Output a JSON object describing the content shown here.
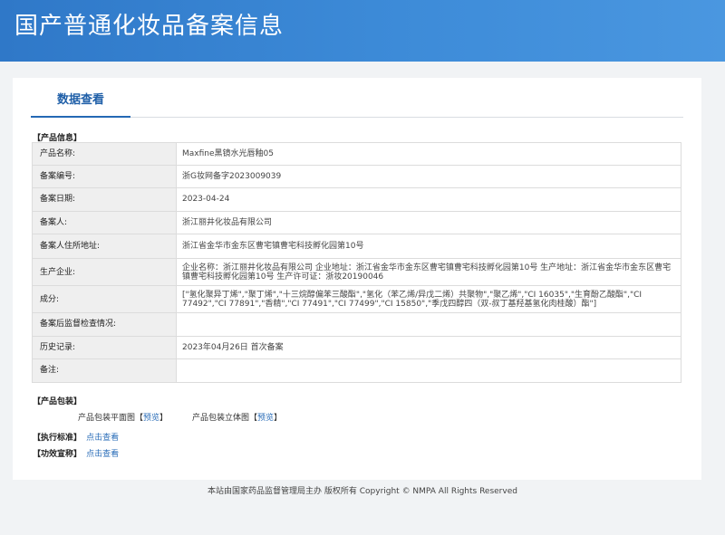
{
  "header": {
    "title": "国产普通化妆品备案信息"
  },
  "tabs": [
    {
      "label": "数据查看"
    }
  ],
  "sections": {
    "product_info": "【产品信息】",
    "packaging": "【产品包装】",
    "standard": "【执行标准】",
    "efficacy": "【功效宣称】"
  },
  "rows": [
    {
      "label": "产品名称:",
      "value": "Maxfine黑镜水光唇釉05"
    },
    {
      "label": "备案编号:",
      "value": "浙G妆网备字2023009039"
    },
    {
      "label": "备案日期:",
      "value": "2023-04-24"
    },
    {
      "label": "备案人:",
      "value": "浙江丽井化妆品有限公司"
    },
    {
      "label": "备案人住所地址:",
      "value": "浙江省金华市金东区曹宅镇曹宅科技孵化园第10号"
    },
    {
      "label": "生产企业:",
      "value": "企业名称：浙江丽井化妆品有限公司 企业地址：浙江省金华市金东区曹宅镇曹宅科技孵化园第10号 生产地址：浙江省金华市金东区曹宅镇曹宅科技孵化园第10号 生产许可证：浙妆20190046"
    },
    {
      "label": "成分:",
      "value": "[\"氢化聚异丁烯\",\"聚丁烯\",\"十三烷醇偏苯三酸酯\",\"氢化（苯乙烯/异戊二烯）共聚物\",\"聚乙烯\",\"CI 16035\",\"生育酚乙酸酯\",\"CI 77492\",\"CI 77891\",\"香精\",\"CI 77491\",\"CI 77499\",\"CI 15850\",\"季戊四醇四（双-叔丁基羟基氢化肉桂酸）酯\"]"
    },
    {
      "label": "备案后监督检查情况:",
      "value": ""
    },
    {
      "label": "历史记录:",
      "value": "2023年04月26日 首次备案"
    },
    {
      "label": "备注:",
      "value": ""
    }
  ],
  "packaging": {
    "flat_label": "产品包装平面图",
    "stereo_label": "产品包装立体图",
    "bracket_open": "【",
    "bracket_close": "】",
    "preview_link": "预览"
  },
  "links": {
    "view": "点击查看"
  },
  "footer": {
    "text": "本站由国家药品监督管理局主办 版权所有 Copyright © NMPA All Rights Reserved"
  }
}
